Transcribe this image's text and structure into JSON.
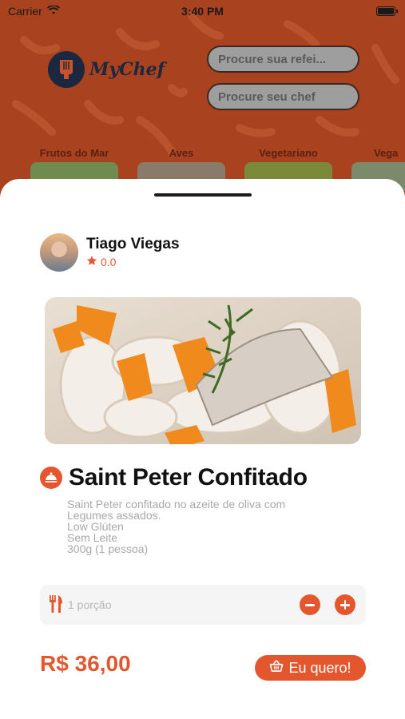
{
  "status_bar": {
    "carrier": "Carrier",
    "time": "3:40 PM"
  },
  "background_screen": {
    "logo_text": "MyChef",
    "search_meal_placeholder": "Procure sua refei...",
    "search_chef_placeholder": "Procure seu chef",
    "categories": [
      {
        "label": "Frutos do Mar"
      },
      {
        "label": "Aves"
      },
      {
        "label": "Vegetariano"
      },
      {
        "label": "Vega"
      }
    ]
  },
  "chef": {
    "name": "Tiago Viegas",
    "rating": "0.0"
  },
  "dish": {
    "title": "Saint Peter Confitado",
    "description_lines": [
      "Saint Peter confitado no azeite de oliva com",
      "Legumes assados.",
      "Low Glúten",
      "Sem Leite",
      "300g (1 pessoa)"
    ]
  },
  "portion": {
    "label": "1 porção"
  },
  "price": "R$ 36,00",
  "buy_button_label": "Eu quero!",
  "colors": {
    "accent": "#e4572e",
    "background_overlay": "#a8421f",
    "text_dark": "#111111",
    "text_muted": "#a9a9a9"
  },
  "icons": {
    "wifi": "wifi-icon",
    "battery": "battery-icon",
    "logo": "chef-logo-icon",
    "star": "star-icon",
    "dish": "cloche-icon",
    "portion": "fork-knife-icon",
    "minus": "minus-icon",
    "plus": "plus-icon",
    "basket": "basket-icon"
  }
}
